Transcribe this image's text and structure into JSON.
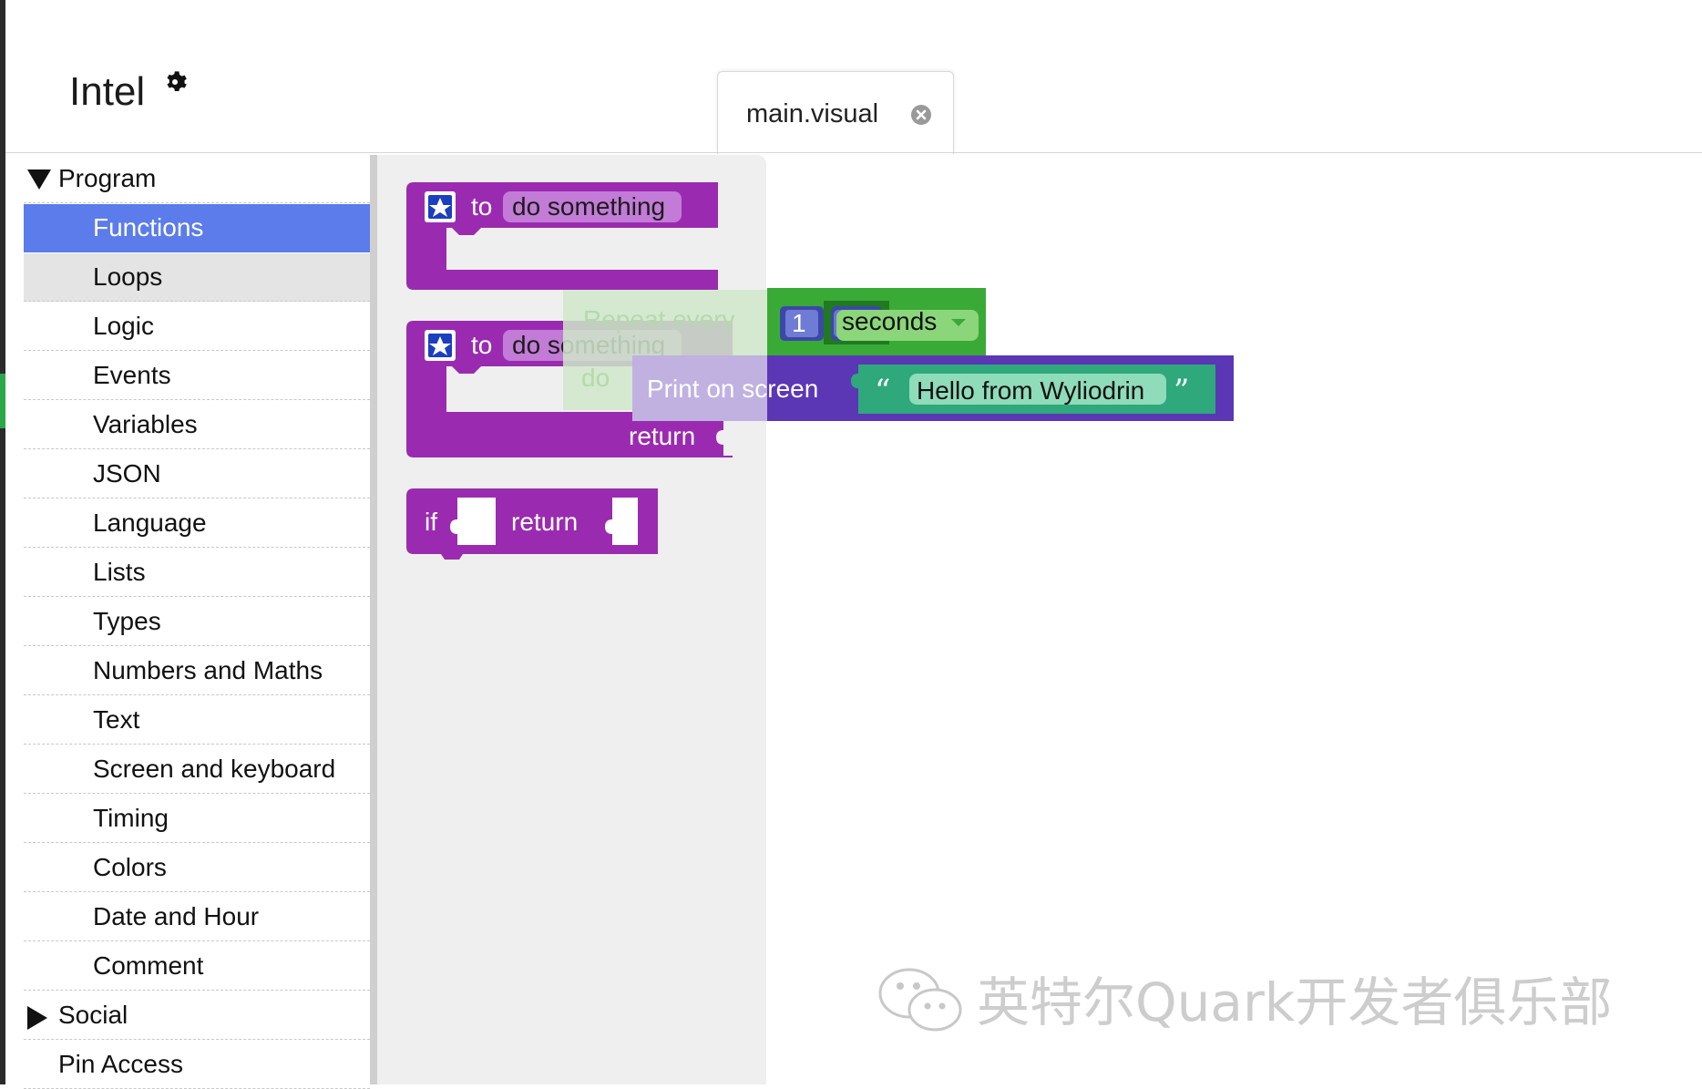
{
  "project": {
    "title": "Intel"
  },
  "tab": {
    "label": "main.visual"
  },
  "sidebar": {
    "categories": [
      {
        "label": "Program",
        "kind": "group-open"
      },
      {
        "label": "Functions",
        "kind": "selected"
      },
      {
        "label": "Loops",
        "kind": "hover"
      },
      {
        "label": "Logic"
      },
      {
        "label": "Events"
      },
      {
        "label": "Variables"
      },
      {
        "label": "JSON"
      },
      {
        "label": "Language"
      },
      {
        "label": "Lists"
      },
      {
        "label": "Types"
      },
      {
        "label": "Numbers and Maths"
      },
      {
        "label": "Text"
      },
      {
        "label": "Screen and keyboard"
      },
      {
        "label": "Timing"
      },
      {
        "label": "Colors"
      },
      {
        "label": "Date and Hour"
      },
      {
        "label": "Comment"
      },
      {
        "label": "Social",
        "kind": "group-closed"
      },
      {
        "label": "Pin Access",
        "kind": "group-item"
      }
    ]
  },
  "flyout": {
    "func1": {
      "to": "to",
      "name": "do something"
    },
    "func2": {
      "to": "to",
      "name": "do something",
      "return": "return"
    },
    "ifreturn": {
      "if": "if",
      "return": "return"
    }
  },
  "workspace": {
    "repeat": {
      "label": "Repeat every",
      "value": "1",
      "unit": "seconds",
      "do": "do"
    },
    "print": {
      "label": "Print on screen",
      "text": "Hello from Wyliodrin",
      "open_quote": "“",
      "close_quote": "”"
    }
  },
  "watermark": {
    "text": "英特尔Quark开发者俱乐部"
  },
  "colors": {
    "function_block": "#9a2bb0",
    "timing_block": "#3aaa36",
    "print_block": "#5b37b5",
    "text_block": "#2fa87c",
    "number_block": "#3c48a8",
    "selected_category": "#5b7cea"
  }
}
